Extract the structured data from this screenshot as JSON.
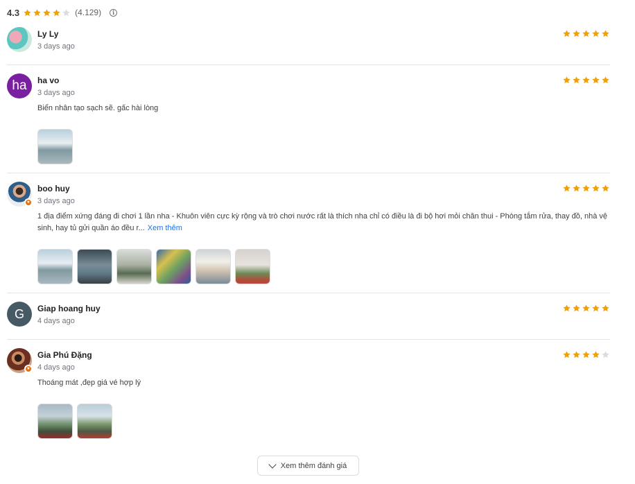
{
  "summary": {
    "score": "4.3",
    "count": "(4.129)",
    "filled_stars": 4,
    "total_stars": 5,
    "info_icon": "info-icon"
  },
  "colors": {
    "star_filled": "#f2a100",
    "star_empty": "#dadce0",
    "link": "#1a73e8"
  },
  "reviews": [
    {
      "name": "Ly Ly",
      "date": "3 days ago",
      "rating": 5,
      "text": "",
      "more_label": "",
      "photos": []
    },
    {
      "name": "ha vo",
      "avatar_letter": "ha",
      "date": "3 days ago",
      "rating": 5,
      "text": "Biển nhân tạo sạch sẽ. gấc hài lòng",
      "more_label": "",
      "photos": [
        "water-photo"
      ]
    },
    {
      "name": "boo huy",
      "date": "3 days ago",
      "rating": 5,
      "text": "1 địa điểm xứng đáng đi chơi 1 lần nha - Khuôn viên cực kỳ rộng và trò chơi nước rất là thích nha chỉ có điều là đi bộ hơi mỏi chân thui - Phòng tắm rửa, thay đồ, nhà vệ sinh, hay tủ gửi quần áo đều r...",
      "more_label": "Xem thêm",
      "photos": [
        "water-photo",
        "game-photo",
        "arcade-photo",
        "hall-photo",
        "mural-photo",
        "dome-photo"
      ]
    },
    {
      "name": "Giap hoang huy",
      "avatar_letter": "G",
      "date": "4 days ago",
      "rating": 5,
      "text": "",
      "more_label": "",
      "photos": []
    },
    {
      "name": "Gia Phú Đặng",
      "date": "4 days ago",
      "rating": 4,
      "text": "Thoáng mát ,đẹp giá vé hợp lý",
      "more_label": "",
      "photos": [
        "pool-photo",
        "pool-photo"
      ]
    }
  ],
  "load_more": {
    "label": "Xem thêm đánh giá",
    "icon": "chevron-down-icon"
  }
}
